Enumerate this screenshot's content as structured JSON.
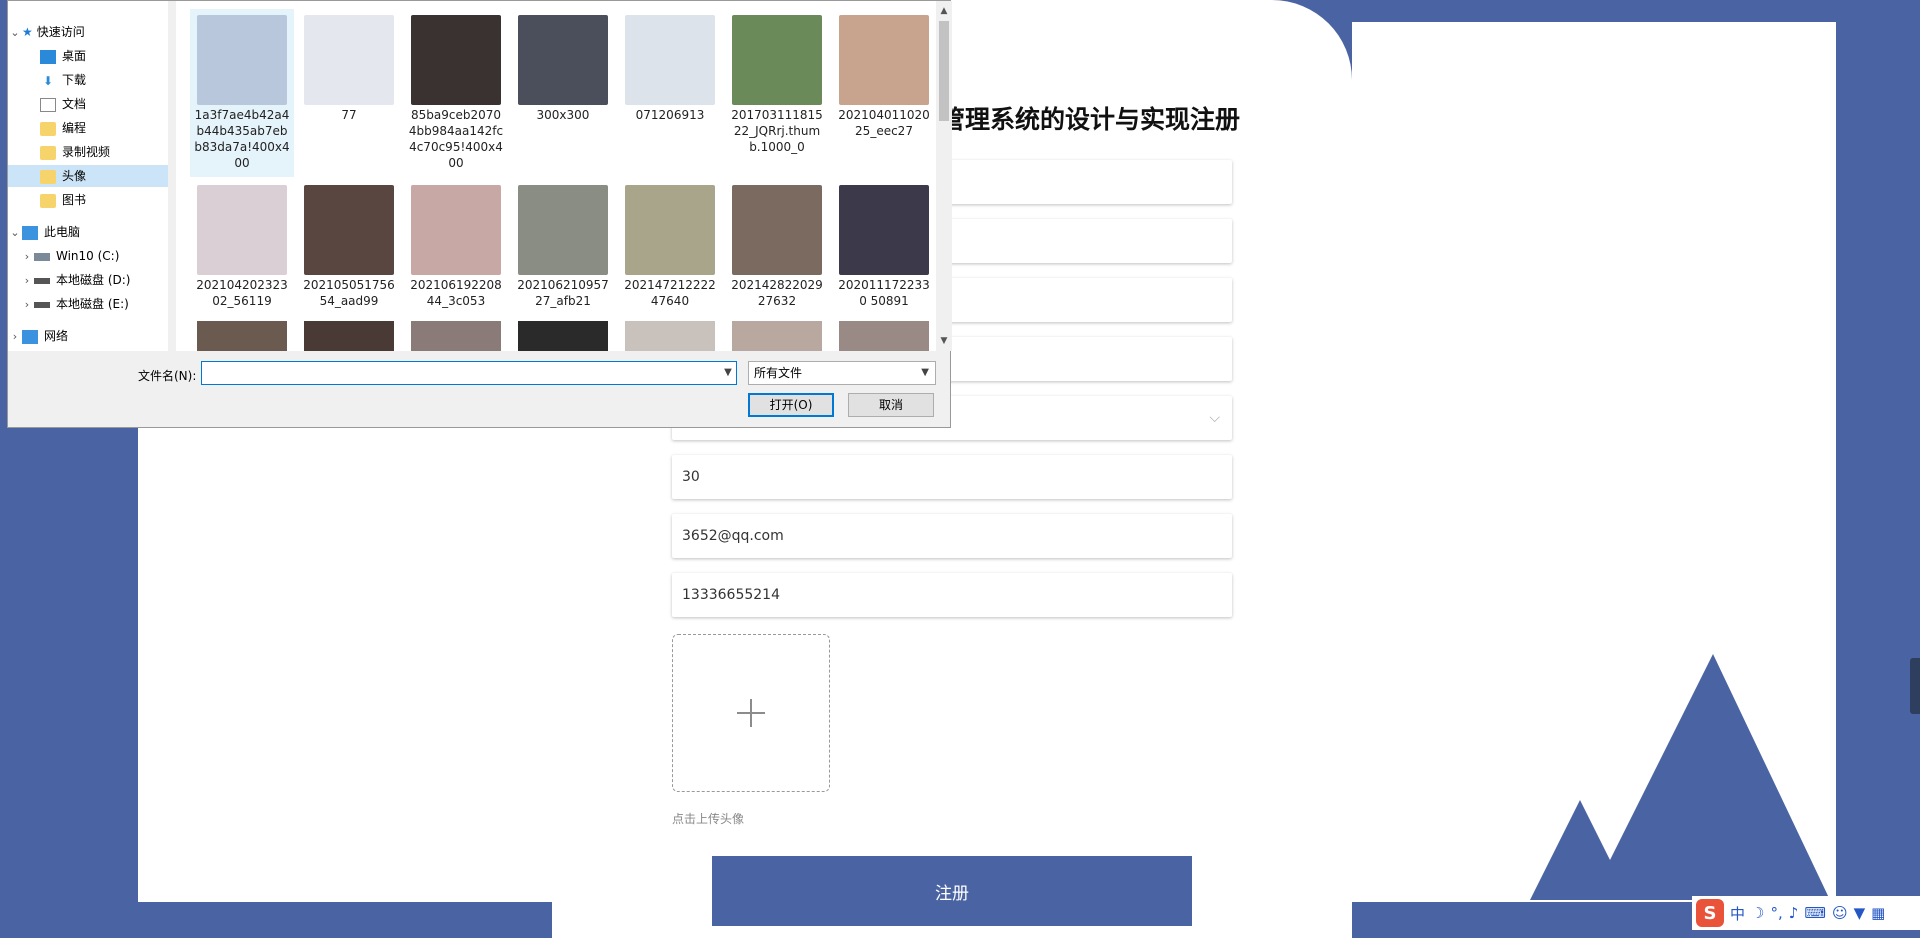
{
  "form": {
    "title": "管理系统的设计与实现注册",
    "fields": {
      "age": "30",
      "email": "3652@qq.com",
      "phone": "13336655214"
    },
    "upload_hint": "点击上传头像",
    "register_label": "注册"
  },
  "dialog": {
    "nav": {
      "quick_access": "快速访问",
      "desktop": "桌面",
      "downloads": "下载",
      "documents": "文档",
      "programming": "编程",
      "recordings": "录制视频",
      "avatars": "头像",
      "books": "图书",
      "this_pc": "此电脑",
      "drive_c": "Win10 (C:)",
      "drive_d": "本地磁盘 (D:)",
      "drive_e": "本地磁盘 (E:)",
      "network": "网络"
    },
    "files": [
      {
        "label": "1a3f7ae4b42a4b44b435ab7ebb83da7a!400x400",
        "color": "#b9c7dc"
      },
      {
        "label": "77",
        "color": "#e4e8ee"
      },
      {
        "label": "85ba9ceb20704bb984aa142fc4c70c95!400x400",
        "color": "#3a3230"
      },
      {
        "label": "300x300",
        "color": "#4b4f5c"
      },
      {
        "label": "071206913",
        "color": "#dde3ea"
      },
      {
        "label": "20170311181522_JQRrj.thumb.1000_0",
        "color": "#6b8a5a"
      },
      {
        "label": "20210401102025_eec27",
        "color": "#c8a48f"
      },
      {
        "label": "20210420232302_56119",
        "color": "#d9cfd4"
      },
      {
        "label": "20210505175654_aad99",
        "color": "#5a4640"
      },
      {
        "label": "20210619220844_3c053",
        "color": "#c7a8a4"
      },
      {
        "label": "20210621095727_afb21",
        "color": "#8a8d84"
      },
      {
        "label": "20214721222247640",
        "color": "#a8a58a"
      },
      {
        "label": "20214282202927632",
        "color": "#7a6a60"
      },
      {
        "label": "2020111722330 50891",
        "color": "#3c3a4a"
      }
    ],
    "filename_label": "文件名(N):",
    "filename_value": "",
    "filetype": "所有文件",
    "open_label": "打开(O)",
    "cancel_label": "取消"
  },
  "tray": {
    "ime": "中",
    "moon": "☽",
    "mic": "🎤"
  },
  "colors": {
    "brand": "#4a63a3",
    "dialog_accent": "#0078d4"
  }
}
